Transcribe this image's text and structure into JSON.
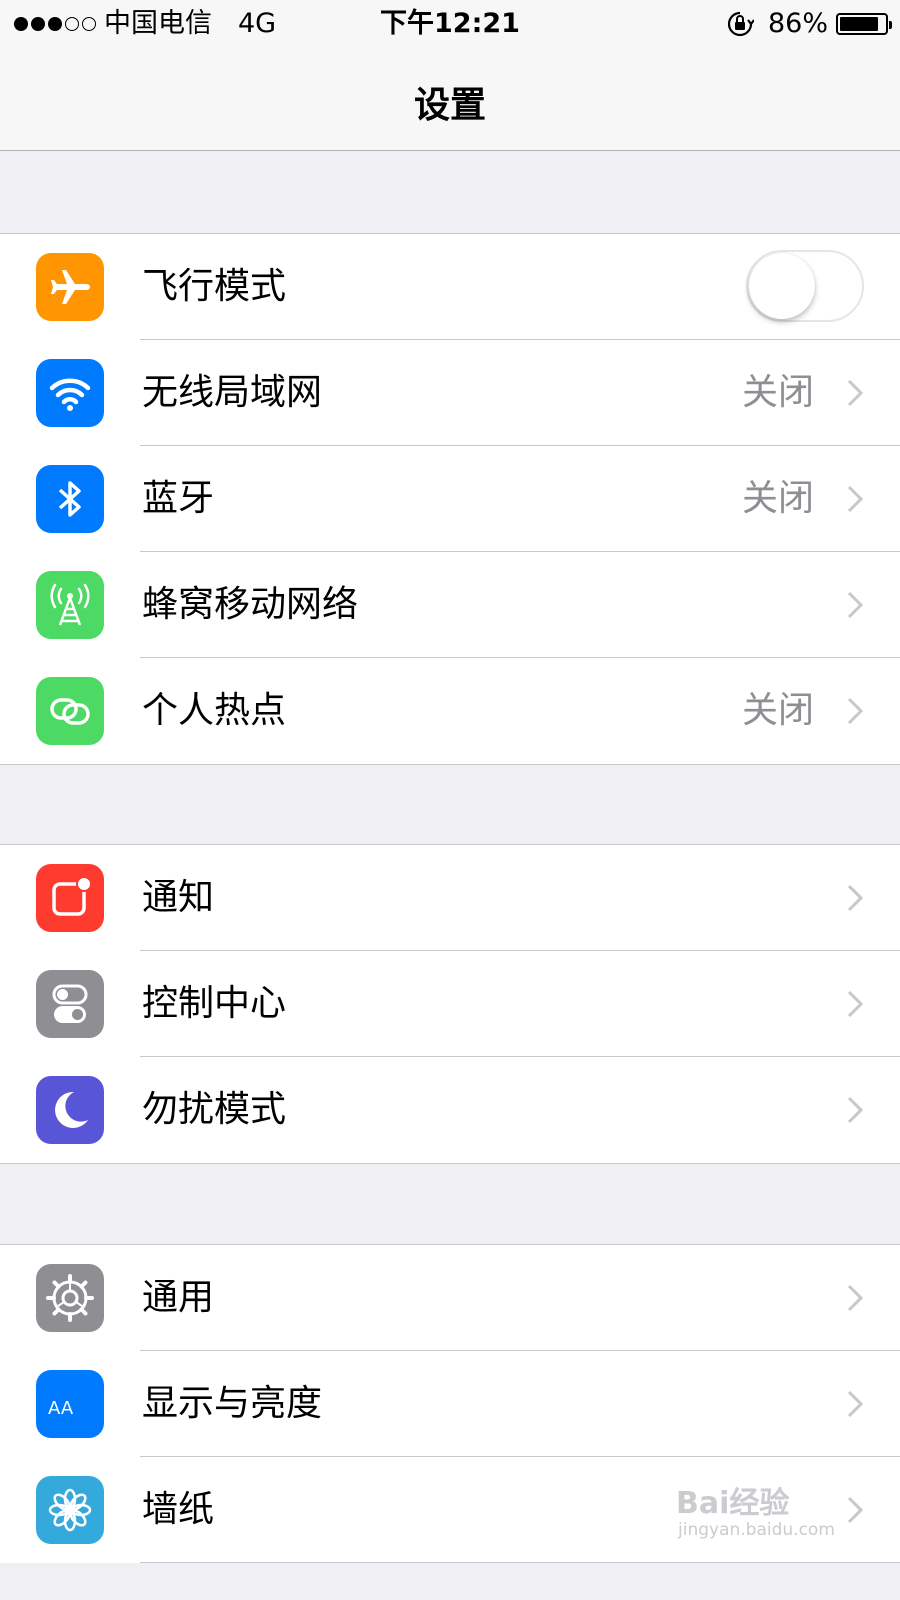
{
  "status_bar": {
    "signal_dots_full": 3,
    "signal_dots_total": 5,
    "carrier": "中国电信",
    "network": "4G",
    "time": "下午12:21",
    "battery_percent_text": "86%",
    "battery_level": 0.86,
    "orientation_lock_icon": "orientation-lock-icon"
  },
  "nav": {
    "title": "设置"
  },
  "groups": [
    {
      "items": [
        {
          "label": "飞行模式",
          "icon": "airplane-icon",
          "color": "#ff9500",
          "control": "toggle",
          "toggle_on": false
        },
        {
          "label": "无线局域网",
          "icon": "wifi-icon",
          "color": "#007aff",
          "value": "关闭"
        },
        {
          "label": "蓝牙",
          "icon": "bluetooth-icon",
          "color": "#007aff",
          "value": "关闭"
        },
        {
          "label": "蜂窝移动网络",
          "icon": "cellular-antenna-icon",
          "color": "#4cd964"
        },
        {
          "label": "个人热点",
          "icon": "hotspot-link-icon",
          "color": "#4cd964",
          "value": "关闭"
        }
      ]
    },
    {
      "items": [
        {
          "label": "通知",
          "icon": "notification-icon",
          "color": "#ff3b30"
        },
        {
          "label": "控制中心",
          "icon": "toggles-icon",
          "color": "#8e8e93"
        },
        {
          "label": "勿扰模式",
          "icon": "moon-icon",
          "color": "#5856d6"
        }
      ]
    },
    {
      "items": [
        {
          "label": "通用",
          "icon": "gear-icon",
          "color": "#8e8e93"
        },
        {
          "label": "显示与亮度",
          "icon": "text-size-icon",
          "color": "#007aff",
          "icon_text": "AA"
        },
        {
          "label": "墙纸",
          "icon": "flower-icon",
          "color": "#34aadc"
        }
      ]
    }
  ],
  "watermark": {
    "brand": "Bai经验",
    "site": "jingyan.baidu.com"
  }
}
